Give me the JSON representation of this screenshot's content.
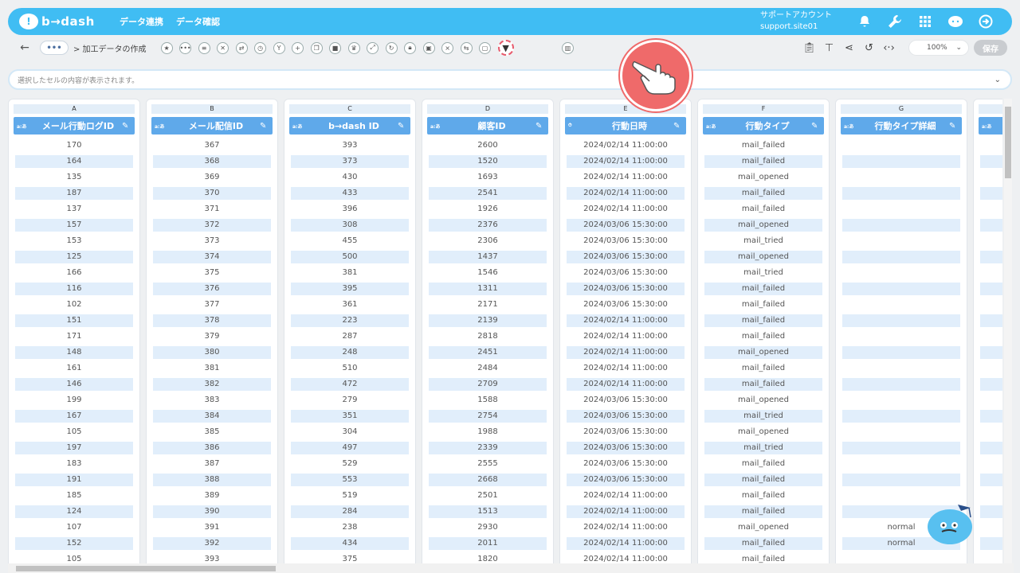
{
  "header": {
    "logo_text": "b→dash",
    "nav": [
      "データ連携",
      "データ確認"
    ],
    "account_line1": "サポートアカウント",
    "account_line2": "support.site01"
  },
  "toolbar": {
    "breadcrumb": "> 加工データの作成",
    "zoom": "100%",
    "save_label": "保存"
  },
  "cellbar": {
    "placeholder": "選択したセルの内容が表示されます。"
  },
  "columns": [
    {
      "letter": "A",
      "type": "a:あ",
      "name": "メール行動ログID",
      "values": [
        "170",
        "164",
        "135",
        "187",
        "137",
        "157",
        "153",
        "125",
        "166",
        "116",
        "102",
        "151",
        "171",
        "148",
        "161",
        "146",
        "199",
        "167",
        "105",
        "197",
        "183",
        "191",
        "185",
        "124",
        "107",
        "152",
        "105"
      ]
    },
    {
      "letter": "B",
      "type": "a:あ",
      "name": "メール配信ID",
      "values": [
        "367",
        "368",
        "369",
        "370",
        "371",
        "372",
        "373",
        "374",
        "375",
        "376",
        "377",
        "378",
        "379",
        "380",
        "381",
        "382",
        "383",
        "384",
        "385",
        "386",
        "387",
        "388",
        "389",
        "390",
        "391",
        "392",
        "393"
      ]
    },
    {
      "letter": "C",
      "type": "a:あ",
      "name": "b→dash ID",
      "values": [
        "393",
        "373",
        "430",
        "433",
        "396",
        "308",
        "455",
        "500",
        "381",
        "395",
        "361",
        "223",
        "287",
        "248",
        "510",
        "472",
        "279",
        "351",
        "304",
        "497",
        "529",
        "553",
        "519",
        "284",
        "238",
        "434",
        "375"
      ]
    },
    {
      "letter": "D",
      "type": "a:あ",
      "name": "顧客ID",
      "values": [
        "2600",
        "1520",
        "1693",
        "2541",
        "1926",
        "2376",
        "2306",
        "1437",
        "1546",
        "1311",
        "2171",
        "2139",
        "2818",
        "2451",
        "2484",
        "2709",
        "1588",
        "2754",
        "1988",
        "2339",
        "2555",
        "2668",
        "2501",
        "1513",
        "2930",
        "2011",
        "1820"
      ]
    },
    {
      "letter": "E",
      "type": "⏱",
      "name": "行動日時",
      "values": [
        "2024/02/14 11:00:00",
        "2024/02/14 11:00:00",
        "2024/02/14 11:00:00",
        "2024/02/14 11:00:00",
        "2024/02/14 11:00:00",
        "2024/03/06 15:30:00",
        "2024/03/06 15:30:00",
        "2024/03/06 15:30:00",
        "2024/03/06 15:30:00",
        "2024/03/06 15:30:00",
        "2024/03/06 15:30:00",
        "2024/02/14 11:00:00",
        "2024/02/14 11:00:00",
        "2024/02/14 11:00:00",
        "2024/02/14 11:00:00",
        "2024/02/14 11:00:00",
        "2024/03/06 15:30:00",
        "2024/03/06 15:30:00",
        "2024/03/06 15:30:00",
        "2024/03/06 15:30:00",
        "2024/03/06 15:30:00",
        "2024/03/06 15:30:00",
        "2024/02/14 11:00:00",
        "2024/02/14 11:00:00",
        "2024/02/14 11:00:00",
        "2024/02/14 11:00:00",
        "2024/02/14 11:00:00"
      ]
    },
    {
      "letter": "F",
      "type": "a:あ",
      "name": "行動タイプ",
      "values": [
        "mail_failed",
        "mail_failed",
        "mail_opened",
        "mail_failed",
        "mail_failed",
        "mail_opened",
        "mail_tried",
        "mail_opened",
        "mail_tried",
        "mail_failed",
        "mail_failed",
        "mail_failed",
        "mail_failed",
        "mail_opened",
        "mail_failed",
        "mail_failed",
        "mail_opened",
        "mail_tried",
        "mail_opened",
        "mail_tried",
        "mail_failed",
        "mail_failed",
        "mail_failed",
        "mail_failed",
        "mail_opened",
        "mail_failed",
        "mail_failed"
      ]
    },
    {
      "letter": "G",
      "type": "a:あ",
      "name": "行動タイプ詳細",
      "values": [
        "",
        "",
        "",
        "",
        "",
        "",
        "",
        "",
        "",
        "",
        "",
        "",
        "",
        "",
        "",
        "",
        "",
        "",
        "",
        "",
        "",
        "",
        "",
        "",
        "normal",
        "normal",
        ""
      ]
    },
    {
      "letter": "",
      "type": "a:あ",
      "name": "",
      "values": []
    }
  ]
}
